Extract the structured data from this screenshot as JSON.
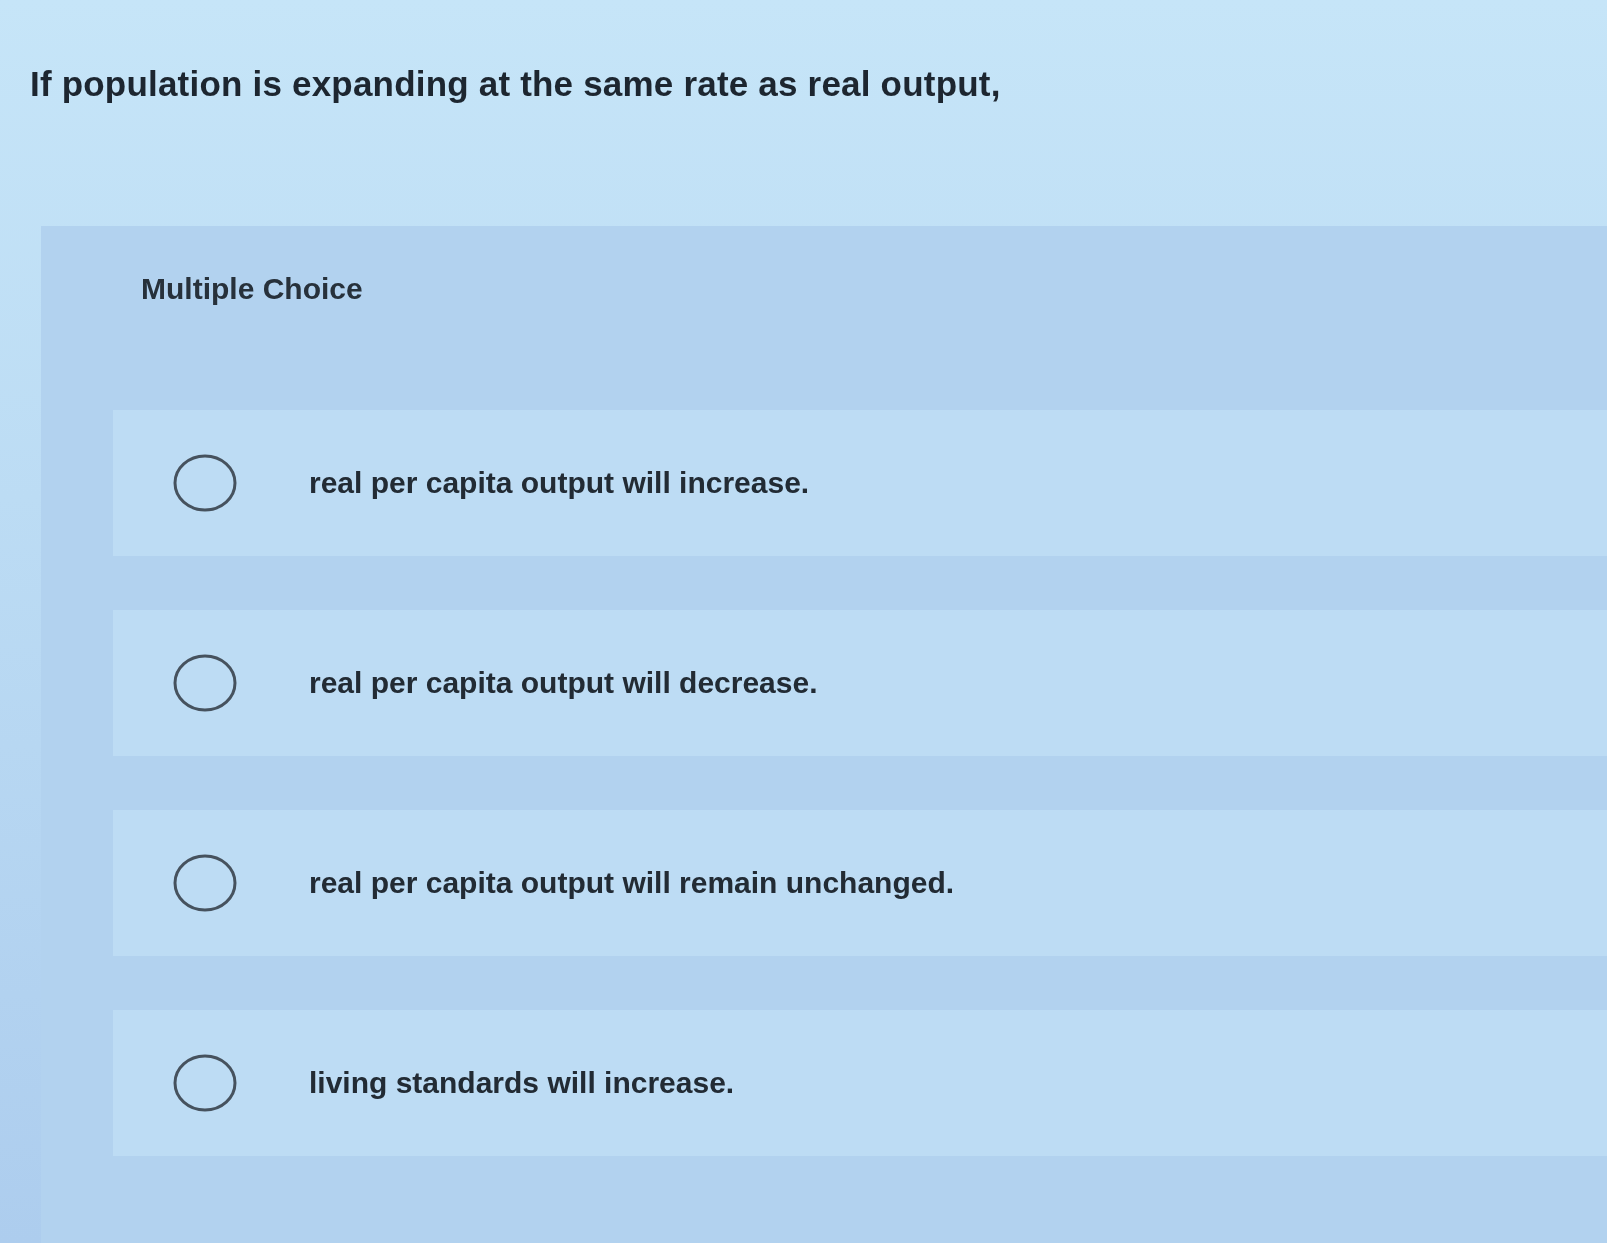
{
  "question": "If population is expanding at the same rate as real output,",
  "answer_panel": {
    "label": "Multiple Choice",
    "options": [
      {
        "text": "real per capita output will increase.",
        "selected": false
      },
      {
        "text": "real per capita output will decrease.",
        "selected": false
      },
      {
        "text": "real per capita output will remain unchanged.",
        "selected": false
      },
      {
        "text": "living standards will increase.",
        "selected": false
      }
    ]
  }
}
